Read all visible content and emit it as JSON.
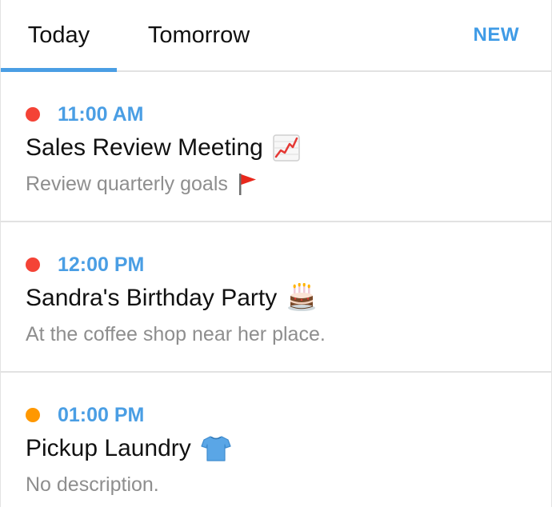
{
  "tabs": [
    {
      "label": "Today",
      "selected": true
    },
    {
      "label": "Tomorrow",
      "selected": false
    }
  ],
  "new_button": {
    "label": "NEW"
  },
  "colors": {
    "accent": "#4a9ee4",
    "dot_red": "#f44336",
    "dot_orange": "#ff9800",
    "description": "#8e8e8e",
    "divider": "#e2e2e2"
  },
  "events": [
    {
      "time": "11:00 AM",
      "title": "Sales Review Meeting",
      "title_icon": "chart-increasing-icon",
      "description": "Review quarterly goals",
      "description_icon": "triangular-flag-icon",
      "dot_color": "red"
    },
    {
      "time": "12:00 PM",
      "title": "Sandra's Birthday Party",
      "title_icon": "birthday-cake-icon",
      "description": "At the coffee shop near her place.",
      "description_icon": "",
      "dot_color": "red"
    },
    {
      "time": "01:00 PM",
      "title": "Pickup Laundry",
      "title_icon": "t-shirt-icon",
      "description": "No description.",
      "description_icon": "",
      "dot_color": "orange"
    }
  ]
}
